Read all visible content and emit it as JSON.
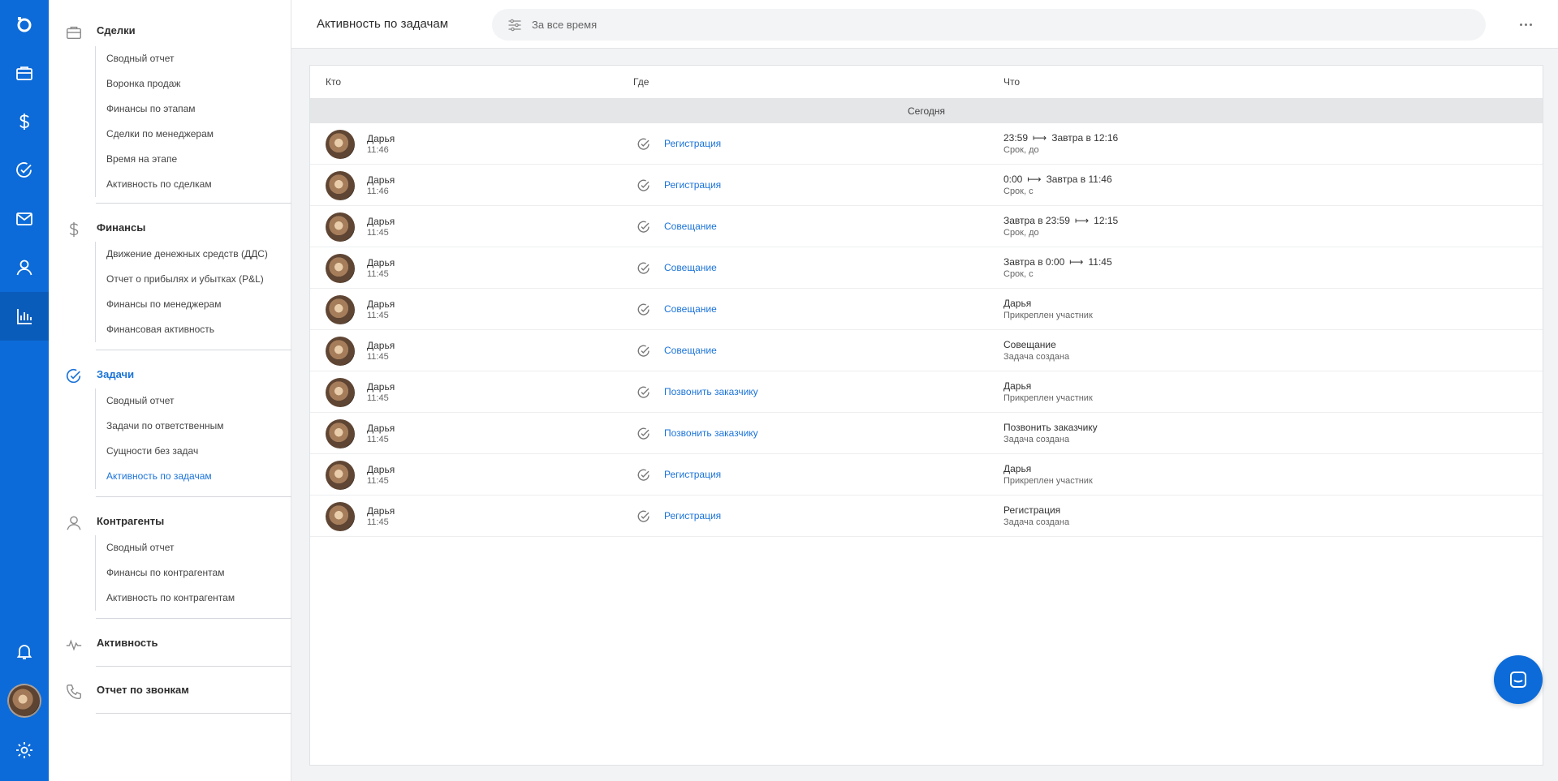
{
  "rail": {
    "items": [
      {
        "icon": "logo-icon"
      },
      {
        "icon": "briefcase-icon"
      },
      {
        "icon": "dollar-icon"
      },
      {
        "icon": "check-circle-icon"
      },
      {
        "icon": "mail-icon"
      },
      {
        "icon": "user-icon"
      },
      {
        "icon": "bar-chart-icon"
      }
    ],
    "bottom": [
      {
        "icon": "bell-icon"
      },
      {
        "icon": "avatar"
      },
      {
        "icon": "gear-icon"
      }
    ],
    "accent": "#0c6bd8"
  },
  "sidebar": {
    "groups": [
      {
        "title": "Сделки",
        "icon": "briefcase-icon",
        "items": [
          "Сводный отчет",
          "Воронка продаж",
          "Финансы по этапам",
          "Сделки по менеджерам",
          "Время на этапе",
          "Активность по сделкам"
        ]
      },
      {
        "title": "Финансы",
        "icon": "dollar-icon",
        "items": [
          "Движение денежных средств (ДДС)",
          "Отчет о прибылях и убытках (P&L)",
          "Финансы по менеджерам",
          "Финансовая активность"
        ]
      },
      {
        "title": "Задачи",
        "icon": "check-circle-icon",
        "items": [
          "Сводный отчет",
          "Задачи по ответственным",
          "Сущности без задач",
          "Активность по задачам"
        ],
        "active_item": "Активность по задачам"
      },
      {
        "title": "Контрагенты",
        "icon": "user-icon",
        "items": [
          "Сводный отчет",
          "Финансы по контрагентам",
          "Активность по контрагентам"
        ]
      },
      {
        "title": "Активность",
        "icon": "pulse-icon",
        "items": []
      },
      {
        "title": "Отчет по звонкам",
        "icon": "phone-icon",
        "items": []
      }
    ]
  },
  "header": {
    "title": "Активность по задачам",
    "filter_label": "За все время"
  },
  "table": {
    "columns": [
      "Кто",
      "Где",
      "Что"
    ],
    "day_label": "Сегодня",
    "rows": [
      {
        "who": "Дарья",
        "time": "11:46",
        "where": "Регистрация",
        "what_main": "23:59",
        "what_arrow": "⟼",
        "what_main2": "Завтра в 12:16",
        "what_sub": "Срок, до"
      },
      {
        "who": "Дарья",
        "time": "11:46",
        "where": "Регистрация",
        "what_main": "0:00",
        "what_arrow": "⟼",
        "what_main2": "Завтра в 11:46",
        "what_sub": "Срок, с"
      },
      {
        "who": "Дарья",
        "time": "11:45",
        "where": "Совещание",
        "what_main": "Завтра в 23:59",
        "what_arrow": "⟼",
        "what_main2": "12:15",
        "what_sub": "Срок, до"
      },
      {
        "who": "Дарья",
        "time": "11:45",
        "where": "Совещание",
        "what_main": "Завтра в 0:00",
        "what_arrow": "⟼",
        "what_main2": "11:45",
        "what_sub": "Срок, с"
      },
      {
        "who": "Дарья",
        "time": "11:45",
        "where": "Совещание",
        "what_main": "Дарья",
        "what_arrow": "",
        "what_main2": "",
        "what_sub": "Прикреплен участник"
      },
      {
        "who": "Дарья",
        "time": "11:45",
        "where": "Совещание",
        "what_main": "Совещание",
        "what_arrow": "",
        "what_main2": "",
        "what_sub": "Задача создана"
      },
      {
        "who": "Дарья",
        "time": "11:45",
        "where": "Позвонить заказчику",
        "what_main": "Дарья",
        "what_arrow": "",
        "what_main2": "",
        "what_sub": "Прикреплен участник"
      },
      {
        "who": "Дарья",
        "time": "11:45",
        "where": "Позвонить заказчику",
        "what_main": "Позвонить заказчику",
        "what_arrow": "",
        "what_main2": "",
        "what_sub": "Задача создана"
      },
      {
        "who": "Дарья",
        "time": "11:45",
        "where": "Регистрация",
        "what_main": "Дарья",
        "what_arrow": "",
        "what_main2": "",
        "what_sub": "Прикреплен участник"
      },
      {
        "who": "Дарья",
        "time": "11:45",
        "where": "Регистрация",
        "what_main": "Регистрация",
        "what_arrow": "",
        "what_main2": "",
        "what_sub": "Задача создана"
      }
    ]
  }
}
